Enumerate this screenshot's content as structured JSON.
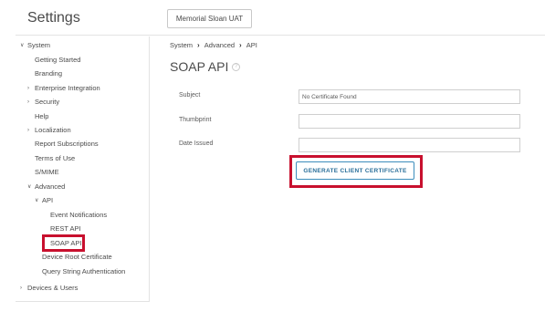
{
  "header": {
    "title": "Settings",
    "org_name": "Memorial Sloan UAT"
  },
  "sidebar": {
    "items": [
      {
        "label": "System",
        "chevron": "down"
      },
      {
        "label": "Getting Started"
      },
      {
        "label": "Branding"
      },
      {
        "label": "Enterprise Integration",
        "chevron": "right"
      },
      {
        "label": "Security",
        "chevron": "right"
      },
      {
        "label": "Help"
      },
      {
        "label": "Localization",
        "chevron": "right"
      },
      {
        "label": "Report Subscriptions"
      },
      {
        "label": "Terms of Use"
      },
      {
        "label": "S/MIME"
      },
      {
        "label": "Advanced",
        "chevron": "down"
      },
      {
        "label": "API",
        "chevron": "down"
      },
      {
        "label": "Event Notifications"
      },
      {
        "label": "REST API"
      },
      {
        "label": "SOAP API"
      },
      {
        "label": "Device Root Certificate"
      },
      {
        "label": "Query String Authentication"
      },
      {
        "label": "Devices & Users",
        "chevron": "right"
      }
    ]
  },
  "breadcrumb": {
    "items": [
      "System",
      "Advanced",
      "API"
    ]
  },
  "main": {
    "title": "SOAP API",
    "fields": [
      {
        "label": "Subject",
        "value": "No Certificate Found"
      },
      {
        "label": "Thumbprint",
        "value": ""
      },
      {
        "label": "Date Issued",
        "value": ""
      }
    ],
    "generate_button": "GENERATE CLIENT CERTIFICATE"
  },
  "colors": {
    "highlight": "#c8102e",
    "button_border": "#3c8dbc",
    "button_text": "#2a6f9a"
  }
}
